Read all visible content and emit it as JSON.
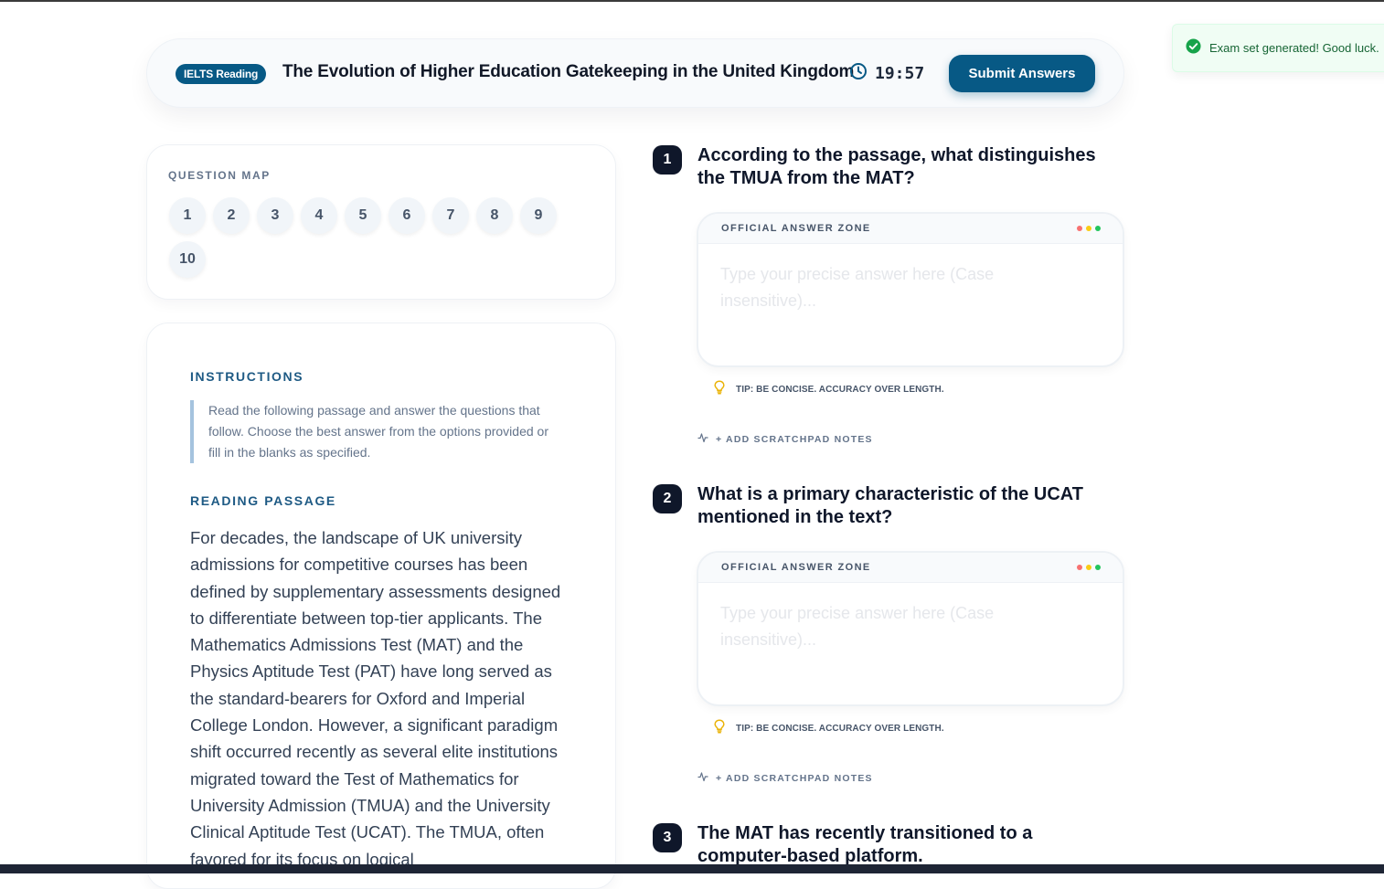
{
  "header": {
    "badge": "IELTS Reading",
    "title": "The Evolution of Higher Education Gatekeeping in the United Kingdom",
    "timer": "19:57",
    "submit_label": "Submit Answers",
    "accent_color": "#075985"
  },
  "toast": {
    "message": "Exam set generated! Good luck.",
    "icon": "check-circle-icon",
    "color": "#16a34a"
  },
  "question_map": {
    "label": "QUESTION MAP",
    "numbers": [
      "1",
      "2",
      "3",
      "4",
      "5",
      "6",
      "7",
      "8",
      "9",
      "10"
    ]
  },
  "instructions": {
    "heading": "INSTRUCTIONS",
    "text": "Read the following passage and answer the questions that follow. Choose the best answer from the options provided or fill in the blanks as specified."
  },
  "passage": {
    "heading": "READING PASSAGE",
    "text": "For decades, the landscape of UK university admissions for competitive courses has been defined by supplementary assessments designed to differentiate between top-tier applicants. The Mathematics Admissions Test (MAT) and the Physics Aptitude Test (PAT) have long served as the standard-bearers for Oxford and Imperial College London. However, a significant paradigm shift occurred recently as several elite institutions migrated toward the Test of Mathematics for University Admission (TMUA) and the University Clinical Aptitude Test (UCAT). The TMUA, often favored for its focus on logical"
  },
  "questions": [
    {
      "number": "1",
      "text": "According to the passage, what distinguishes the TMUA from the MAT?",
      "zone_label": "OFFICIAL ANSWER ZONE",
      "placeholder": "Type your precise answer here (Case insensitive)...",
      "tip": "TIP: BE CONCISE. ACCURACY OVER LENGTH.",
      "scratch_label": "+ ADD SCRATCHPAD NOTES"
    },
    {
      "number": "2",
      "text": "What is a primary characteristic of the UCAT mentioned in the text?",
      "zone_label": "OFFICIAL ANSWER ZONE",
      "placeholder": "Type your precise answer here (Case insensitive)...",
      "tip": "TIP: BE CONCISE. ACCURACY OVER LENGTH.",
      "scratch_label": "+ ADD SCRATCHPAD NOTES"
    },
    {
      "number": "3",
      "text": "The MAT has recently transitioned to a computer-based platform."
    }
  ],
  "zone_dot_colors": [
    "#f87171",
    "#facc15",
    "#22c55e"
  ]
}
